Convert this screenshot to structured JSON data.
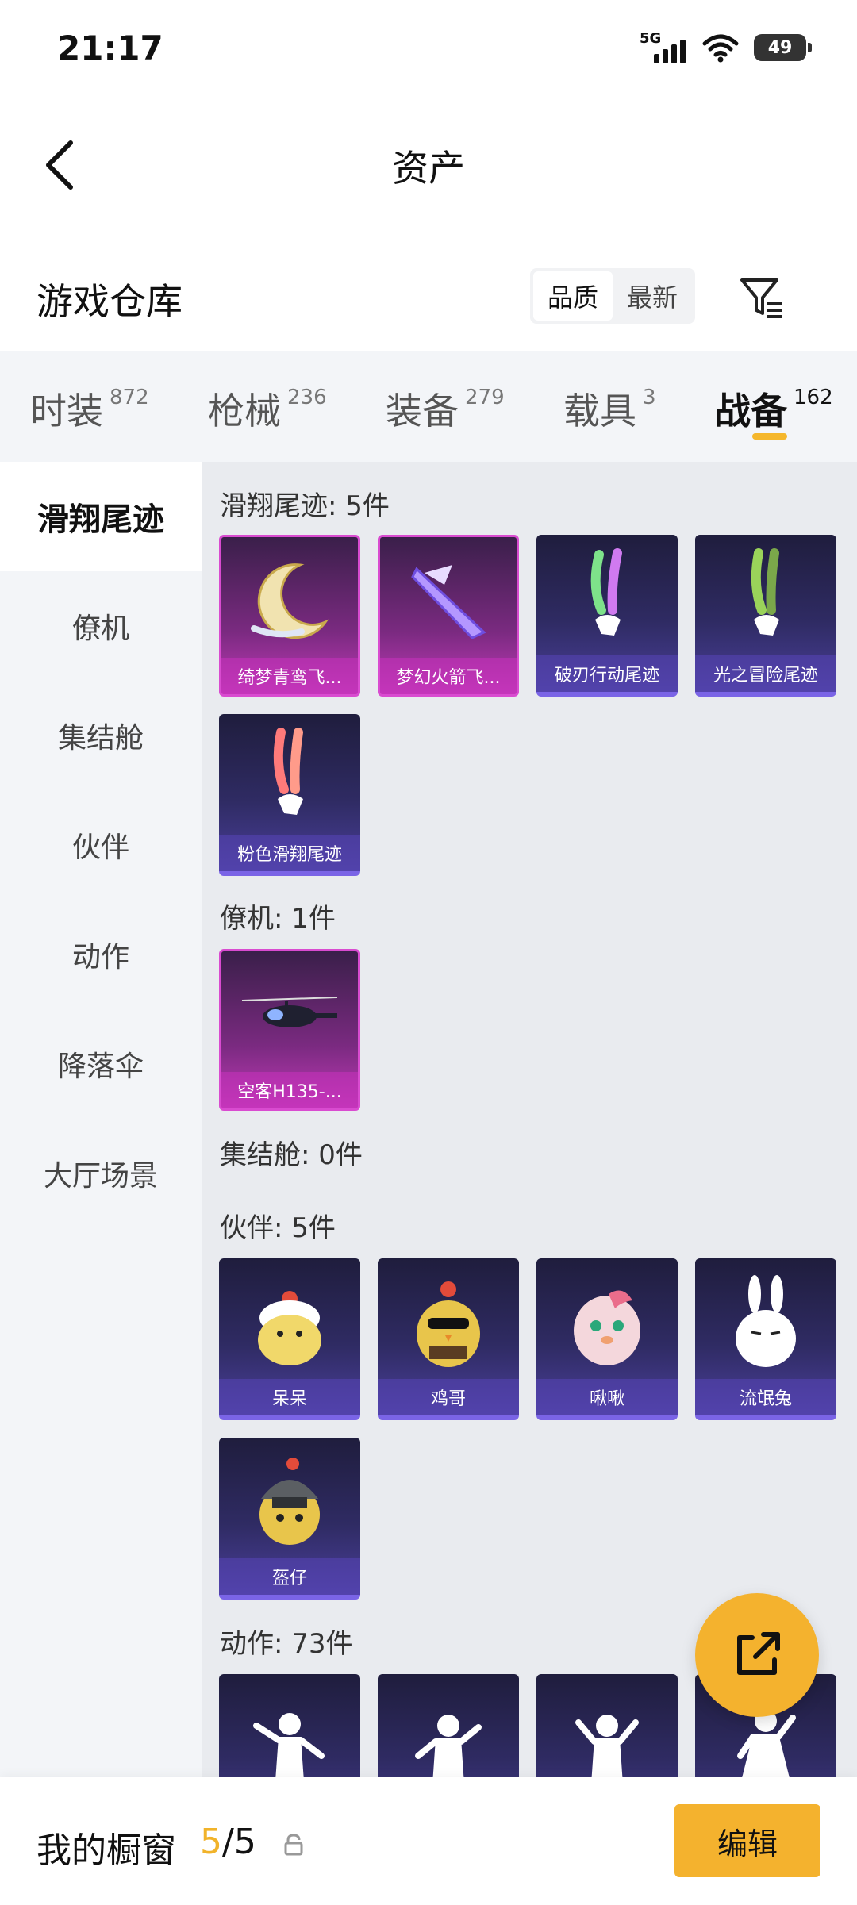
{
  "status_bar": {
    "time": "21:17",
    "network": "5G",
    "battery": "49"
  },
  "header": {
    "title": "资产"
  },
  "warehouse": {
    "title": "游戏仓库",
    "sort": [
      "品质",
      "最新"
    ]
  },
  "tabs": [
    {
      "label": "时装",
      "count": "872"
    },
    {
      "label": "枪械",
      "count": "236"
    },
    {
      "label": "装备",
      "count": "279"
    },
    {
      "label": "载具",
      "count": "3"
    },
    {
      "label": "战备",
      "count": "162"
    }
  ],
  "sidebar": [
    "滑翔尾迹",
    "僚机",
    "集结舱",
    "伙伴",
    "动作",
    "降落伞",
    "大厅场景"
  ],
  "sections": {
    "glide": {
      "title": "滑翔尾迹: 5件",
      "items": [
        "绮梦青鸾飞...",
        "梦幻火箭飞...",
        "破刃行动尾迹",
        "光之冒险尾迹",
        "粉色滑翔尾迹"
      ]
    },
    "wingman": {
      "title": "僚机: 1件",
      "items": [
        "空客H135-..."
      ]
    },
    "rally": {
      "title": "集结舱: 0件"
    },
    "partner": {
      "title": "伙伴: 5件",
      "items": [
        "呆呆",
        "鸡哥",
        "啾啾",
        "流氓兔",
        "盔仔"
      ]
    },
    "action": {
      "title": "动作: 73件"
    }
  },
  "bottom": {
    "title": "我的橱窗",
    "current": "5",
    "sep_total": "/5",
    "edit": "编辑"
  },
  "colors": {
    "accent": "#f4b22e",
    "pink_card": "#c03ab7",
    "blue_card": "#4a3f9a"
  }
}
